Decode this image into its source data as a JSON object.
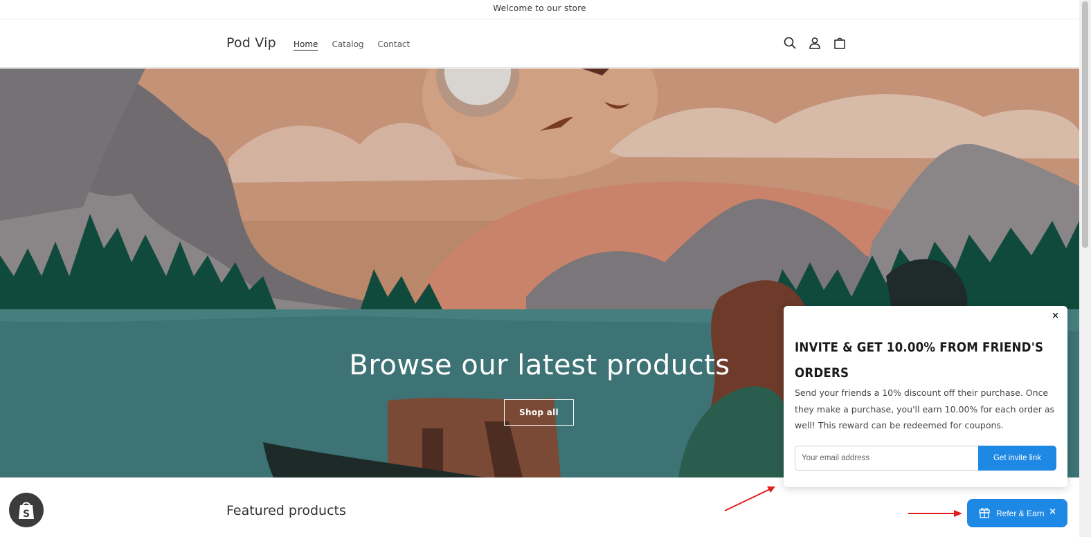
{
  "announcement": {
    "text": "Welcome to our store"
  },
  "header": {
    "logo": "Pod Vip",
    "nav": [
      {
        "label": "Home",
        "active": true
      },
      {
        "label": "Catalog",
        "active": false
      },
      {
        "label": "Contact",
        "active": false
      }
    ],
    "icons": [
      "search-icon",
      "account-icon",
      "cart-icon"
    ]
  },
  "hero": {
    "title": "Browse our latest products",
    "button_label": "Shop all"
  },
  "featured": {
    "title": "Featured products"
  },
  "popup": {
    "close_label": "×",
    "title": "INVITE & GET 10.00% FROM FRIEND'S ORDERS",
    "description": "Send your friends a 10% discount off their purchase. Once they make a purchase, you'll earn 10.00% for each order as well! This reward can be redeemed for coupons.",
    "email_placeholder": "Your email address",
    "button_label": "Get invite link"
  },
  "launcher": {
    "label": "Refer & Earn",
    "close_label": "×"
  },
  "colors": {
    "accent": "#1e88e5",
    "annotation_arrow": "#e11d1d"
  }
}
